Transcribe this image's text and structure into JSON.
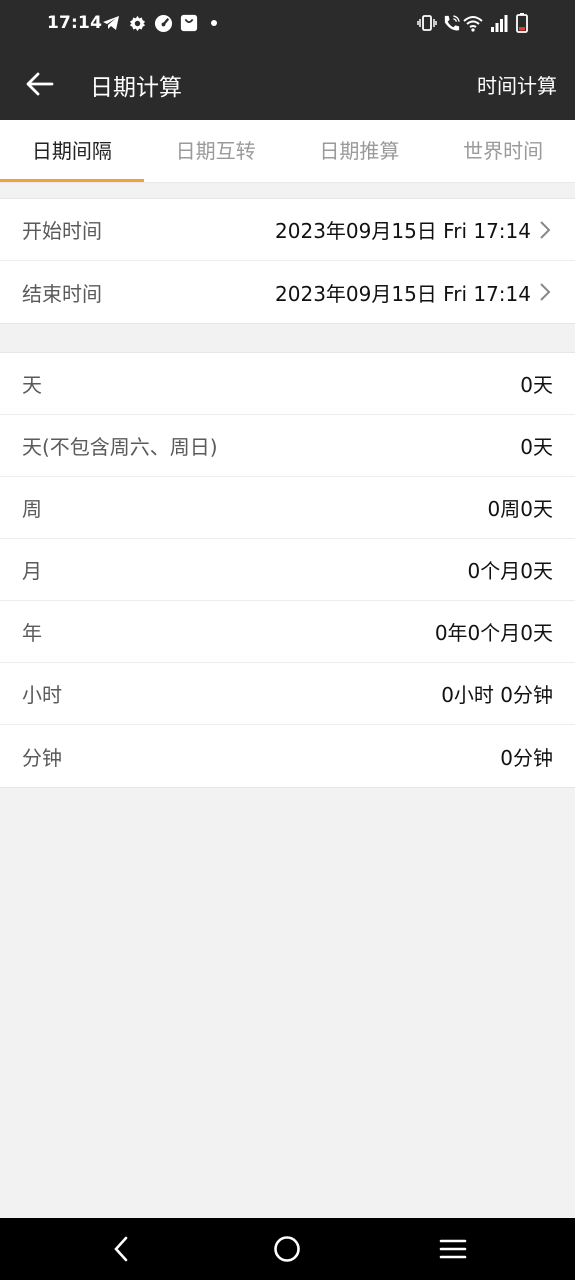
{
  "status_bar": {
    "time": "17:14",
    "left_icons": [
      "telegram-icon",
      "gear-icon",
      "speedometer-icon",
      "shopping-bag-icon",
      "dot-icon"
    ],
    "right_icons": [
      "vibrate-icon",
      "wifi-call-icon",
      "wifi-icon",
      "signal-icon",
      "battery-icon"
    ]
  },
  "appbar": {
    "title": "日期计算",
    "action": "时间计算"
  },
  "tabs": [
    {
      "label": "日期间隔",
      "active": true
    },
    {
      "label": "日期互转",
      "active": false
    },
    {
      "label": "日期推算",
      "active": false
    },
    {
      "label": "世界时间",
      "active": false
    }
  ],
  "range": {
    "start": {
      "label": "开始时间",
      "value": "2023年09月15日 Fri 17:14"
    },
    "end": {
      "label": "结束时间",
      "value": "2023年09月15日 Fri 17:14"
    }
  },
  "results": [
    {
      "label": "天",
      "value": "0天"
    },
    {
      "label": "天(不包含周六、周日)",
      "value": "0天"
    },
    {
      "label": "周",
      "value": "0周0天"
    },
    {
      "label": "月",
      "value": "0个月0天"
    },
    {
      "label": "年",
      "value": "0年0个月0天"
    },
    {
      "label": "小时",
      "value": "0小时 0分钟"
    },
    {
      "label": "分钟",
      "value": "0分钟"
    }
  ],
  "colors": {
    "bar": "#2b2b2b",
    "accent": "#f0a33a",
    "background": "#f2f2f2"
  }
}
